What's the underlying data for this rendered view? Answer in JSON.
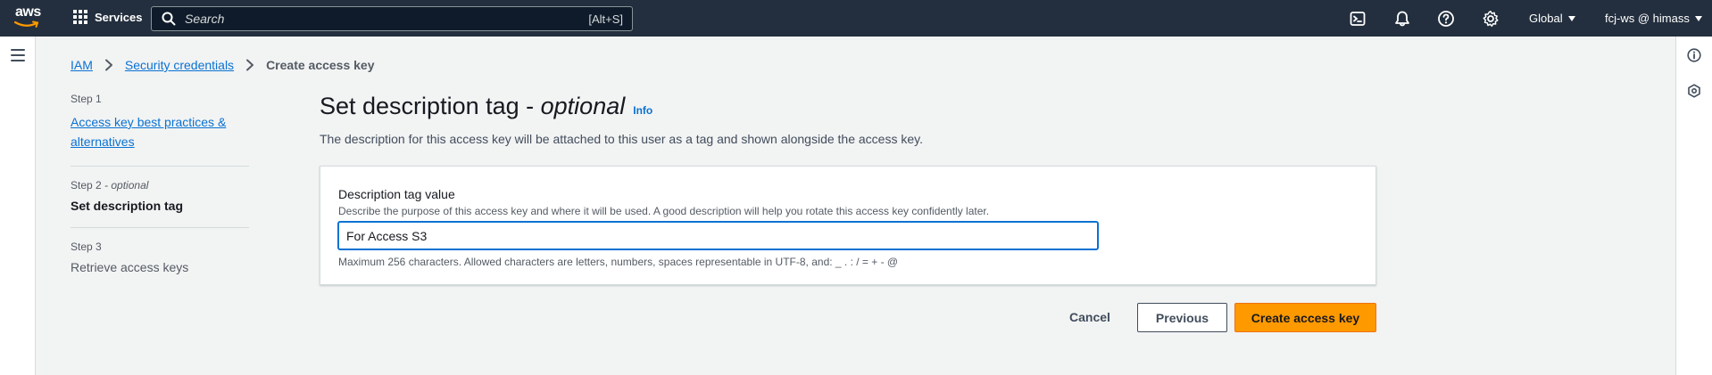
{
  "topnav": {
    "logo_text": "aws",
    "services_label": "Services",
    "search": {
      "placeholder": "Search",
      "shortcut": "[Alt+S]"
    },
    "region_label": "Global",
    "account_label": "fcj-ws @ himass",
    "icons": [
      "cloudshell-icon",
      "notifications-icon",
      "help-icon",
      "settings-icon"
    ]
  },
  "breadcrumb": {
    "items": [
      "IAM",
      "Security credentials"
    ],
    "current": "Create access key"
  },
  "steps": [
    {
      "label": "Step 1",
      "title": "Access key best practices &",
      "title2": "alternatives"
    },
    {
      "label": "Step 2",
      "label_suffix": "- optional",
      "title": "Set description tag"
    },
    {
      "label": "Step 3",
      "title": "Retrieve access keys"
    }
  ],
  "main": {
    "title_prefix": "Set description tag - ",
    "title_optional": "optional",
    "info_label": "Info",
    "description": "The description for this access key will be attached to this user as a tag and shown alongside the access key."
  },
  "form": {
    "label": "Description tag value",
    "hint": "Describe the purpose of this access key and where it will be used. A good description will help you rotate this access key confidently later.",
    "value": "For Access S3",
    "constraint": "Maximum 256 characters. Allowed characters are letters, numbers, spaces representable in UTF-8, and: _ . : / = + - @"
  },
  "actions": {
    "cancel": "Cancel",
    "previous": "Previous",
    "create": "Create access key"
  },
  "colors": {
    "nav_bg": "#232f3e",
    "link": "#0972d3",
    "primary_button": "#ff9900",
    "page_bg": "#f2f3f3"
  }
}
